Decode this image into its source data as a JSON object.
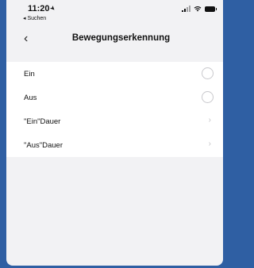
{
  "status_bar": {
    "time": "11:20",
    "back_app": "◂ Suchen"
  },
  "nav": {
    "back": "‹",
    "title": "Bewegungserkennung"
  },
  "options": [
    {
      "label": "Ein",
      "control": "radio",
      "selected": false
    },
    {
      "label": "Aus",
      "control": "radio",
      "selected": false
    },
    {
      "label": "\"Ein\"Dauer",
      "control": "chevron"
    },
    {
      "label": "\"Aus\"Dauer",
      "control": "chevron"
    }
  ],
  "icons": {
    "chevron": "›",
    "location": "➤"
  },
  "colors": {
    "background": "#2f5fa3",
    "screen": "#f2f2f4",
    "list": "#ffffff"
  }
}
